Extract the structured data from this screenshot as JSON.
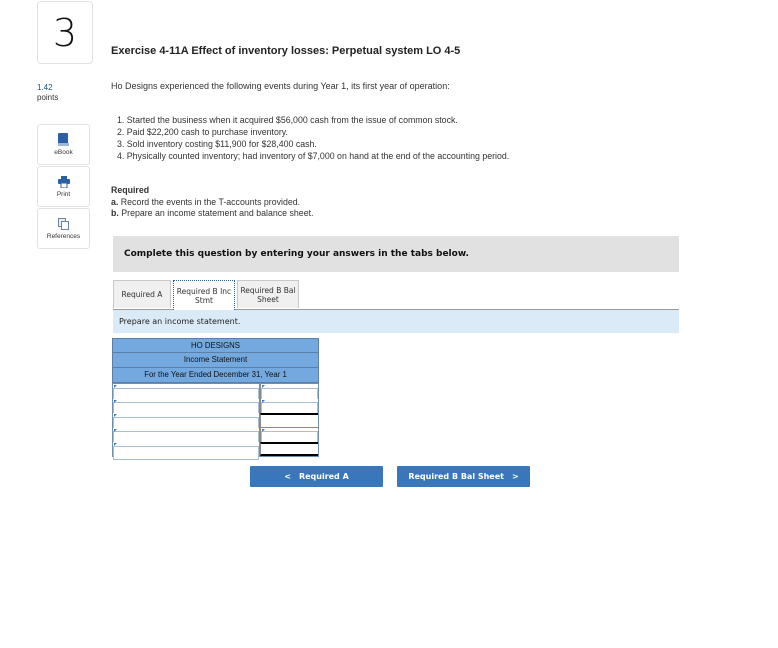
{
  "question": {
    "number": "3",
    "points_value": "1.42",
    "points_label": "points"
  },
  "side_tools": [
    {
      "label": "eBook",
      "icon": "book-icon"
    },
    {
      "label": "Print",
      "icon": "printer-icon"
    },
    {
      "label": "References",
      "icon": "copy-pages-icon"
    }
  ],
  "exercise": {
    "title": "Exercise 4-11A Effect of inventory losses: Perpetual system LO 4-5",
    "intro": "Ho Designs experienced the following events during Year 1, its first year of operation:",
    "events": [
      "1. Started the business when it acquired $56,000 cash from the issue of common stock.",
      "2. Paid $22,200 cash to purchase inventory.",
      "3. Sold inventory costing $11,900 for $28,400 cash.",
      "4. Physically counted inventory; had inventory of $7,000 on hand at the end of the accounting period."
    ],
    "required_heading": "Required",
    "required_items": [
      {
        "letter": "a.",
        "text": "Record the events in the T-accounts provided."
      },
      {
        "letter": "b.",
        "text": "Prepare an income statement and balance sheet."
      }
    ]
  },
  "banner": "Complete this question by entering your answers in the tabs below.",
  "tabs": [
    {
      "label_line1": "Required A",
      "label_line2": "",
      "active": false
    },
    {
      "label_line1": "Required B Inc",
      "label_line2": "Stmt",
      "active": true
    },
    {
      "label_line1": "Required B Bal",
      "label_line2": "Sheet",
      "active": false
    }
  ],
  "instruction": "Prepare an income statement.",
  "statement": {
    "company": "HO DESIGNS",
    "name": "Income Statement",
    "period": "For the Year Ended December 31, Year 1",
    "rows": [
      {
        "label": "",
        "amount": "",
        "amount_editable": true
      },
      {
        "label": "",
        "amount": "",
        "amount_editable": true
      },
      {
        "label": "",
        "amount": "",
        "amount_editable": false
      },
      {
        "label": "",
        "amount": "",
        "amount_editable": true
      },
      {
        "label": "",
        "amount": "",
        "amount_editable": false
      }
    ]
  },
  "nav": {
    "prev_label": "Required A",
    "prev_icon": "<",
    "next_label": "Required B Bal Sheet",
    "next_icon": ">"
  },
  "colors": {
    "accent_button": "#3a76ba",
    "header_blue": "#74a9e0",
    "instruction_bg": "#dbeaf7",
    "banner_bg": "#e1e1e1"
  }
}
